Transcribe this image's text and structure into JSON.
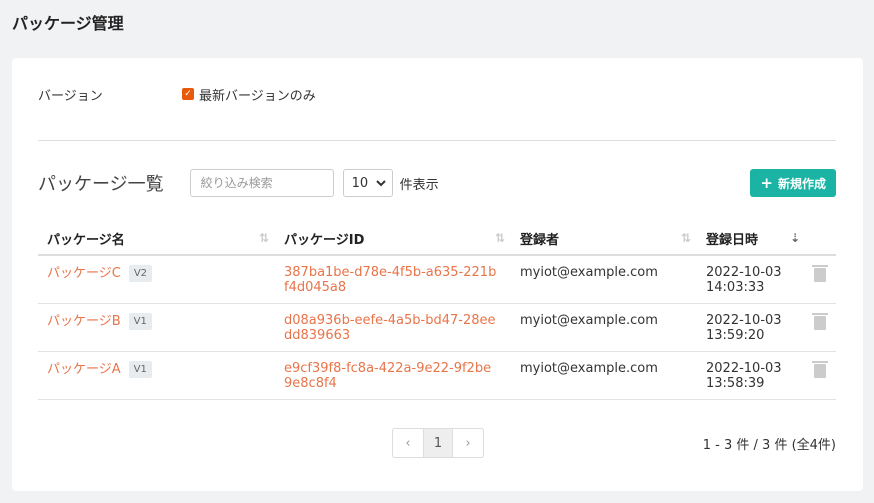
{
  "page": {
    "title": "パッケージ管理"
  },
  "filter": {
    "label": "バージョン",
    "latest_only_label": "最新バージョンのみ",
    "latest_only_checked": true
  },
  "list": {
    "title": "パッケージ一覧",
    "search_placeholder": "絞り込み検索",
    "page_size": "10",
    "page_size_suffix": "件表示",
    "new_button_label": "新規作成"
  },
  "table": {
    "headers": [
      "パッケージ名",
      "パッケージID",
      "登録者",
      "登録日時"
    ],
    "rows": [
      {
        "name": "パッケージC",
        "version": "V2",
        "id": "387ba1be-d78e-4f5b-a635-221bf4d045a8",
        "registrant": "myiot@example.com",
        "date": "2022-10-03",
        "time": "14:03:33"
      },
      {
        "name": "パッケージB",
        "version": "V1",
        "id": "d08a936b-eefe-4a5b-bd47-28eedd839663",
        "registrant": "myiot@example.com",
        "date": "2022-10-03",
        "time": "13:59:20"
      },
      {
        "name": "パッケージA",
        "version": "V1",
        "id": "e9cf39f8-fc8a-422a-9e22-9f2be9e8c8f4",
        "registrant": "myiot@example.com",
        "date": "2022-10-03",
        "time": "13:58:39"
      }
    ]
  },
  "pagination": {
    "prev": "‹",
    "current": "1",
    "next": "›",
    "summary": "1 - 3 件 / 3 件 (全4件)"
  },
  "colors": {
    "accent": "#e8744a",
    "primary_button": "#1bb4a4",
    "checkbox": "#e8590c"
  },
  "icons": {
    "sort": "sort-icon",
    "delete": "trash-icon",
    "add": "plus-icon",
    "dropdown": "chevron-down-icon"
  }
}
